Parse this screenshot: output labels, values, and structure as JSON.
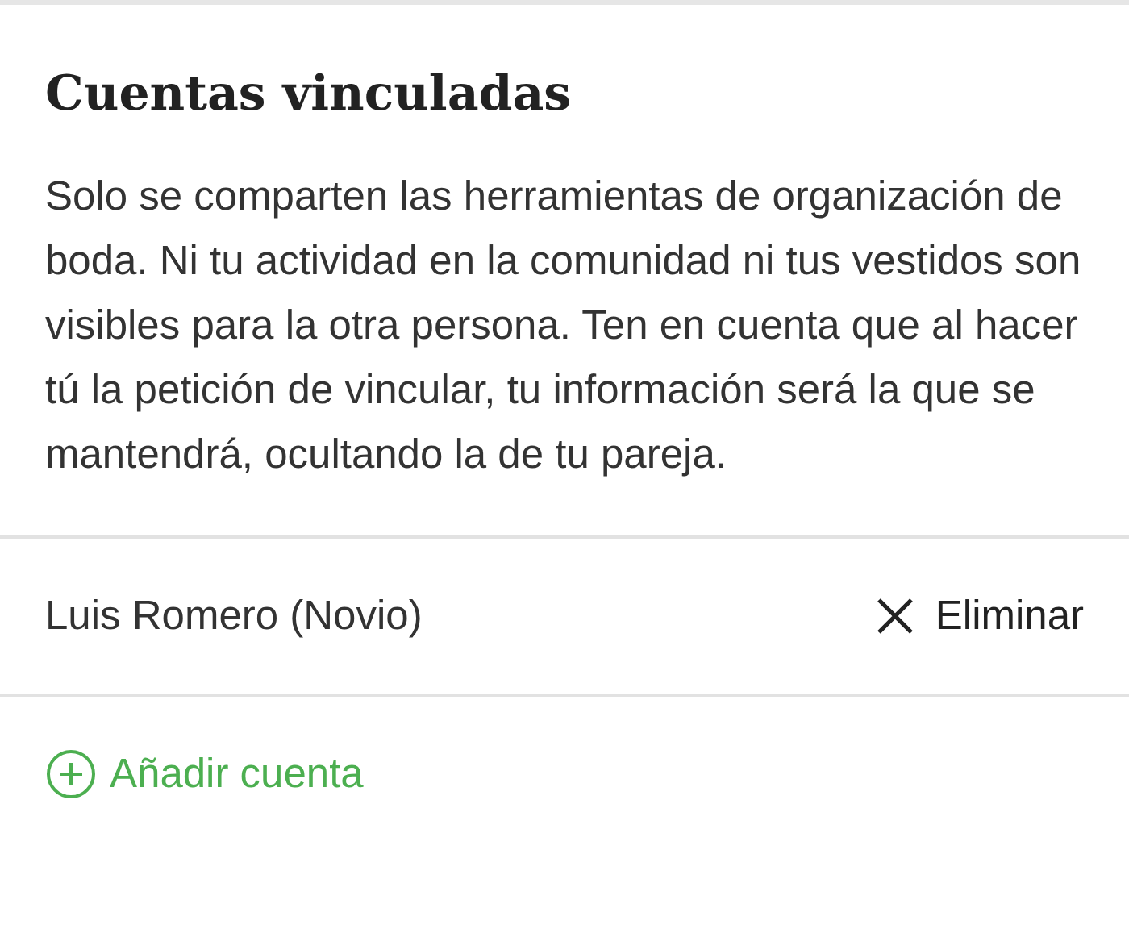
{
  "title": "Cuentas vinculadas",
  "description": "Solo se comparten las herramientas de organización de boda. Ni tu actividad en la comunidad ni tus vestidos son visibles para la otra persona. Ten en cuenta que al hacer tú la petición de vincular, tu información será la que se mantendrá, ocultando la de tu pareja.",
  "linked_accounts": [
    {
      "name": "Luis Romero (Novio)",
      "action": "Eliminar"
    }
  ],
  "add_button": "Añadir cuenta"
}
